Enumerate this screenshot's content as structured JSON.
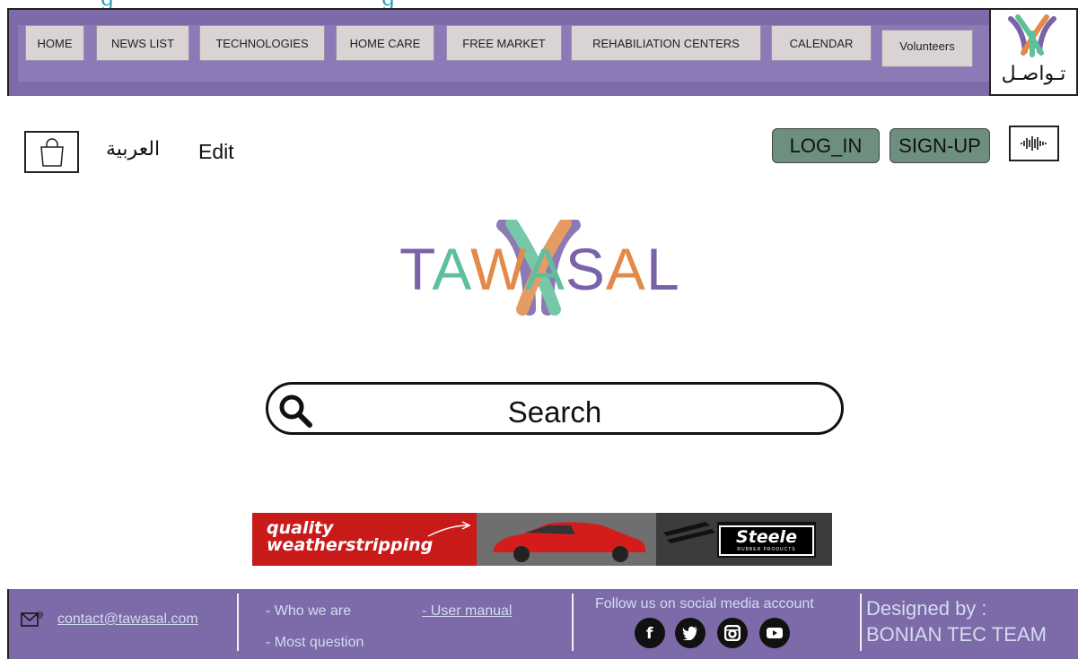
{
  "nav": {
    "items": [
      {
        "label": "HOME"
      },
      {
        "label": "NEWS LIST"
      },
      {
        "label": "TECHNOLOGIES"
      },
      {
        "label": "HOME CARE"
      },
      {
        "label": "FREE MARKET"
      },
      {
        "label": "REHABILIATION CENTERS"
      },
      {
        "label": "CALENDAR"
      },
      {
        "label": "Volunteers"
      }
    ],
    "logo_text": "تـواصـل"
  },
  "header": {
    "arabic_link": "العربية",
    "edit_link": "Edit",
    "login_label": "LOG_IN",
    "signup_label": "SIGN-UP"
  },
  "hero": {
    "logo_word": "TAWASAL",
    "logo_letter_colors": [
      "#7a62a8",
      "#5fbf9b",
      "#e38a4a",
      "#5fbf9b",
      "#7a62a8",
      "#e38a4a",
      "#7a62a8"
    ]
  },
  "search": {
    "label": "Search"
  },
  "ad": {
    "line1": "quality",
    "line2": "weatherstripping",
    "brand": "Steele",
    "brand_sub": "RUBBER PRODUCTS"
  },
  "footer": {
    "email": "contact@tawasal.com",
    "who_we_are": "- Who we are",
    "user_manual": "- User manual",
    "most_question": "- Most question",
    "follow_text": "Follow us on social media account",
    "designed_by": "Designed by :",
    "team": "BONIAN TEC TEAM"
  },
  "colors": {
    "nav_bg": "#7d6aa8",
    "nav_button_bg": "#d9d3d3",
    "auth_button_bg": "#6d8f80",
    "footer_bg": "#7d6aa8",
    "ad_bg": "#c91a1a"
  },
  "icons": [
    "shopping-bag-icon",
    "audio-wave-icon",
    "search-icon",
    "mail-icon",
    "facebook-icon",
    "twitter-icon",
    "instagram-icon",
    "youtube-icon"
  ]
}
